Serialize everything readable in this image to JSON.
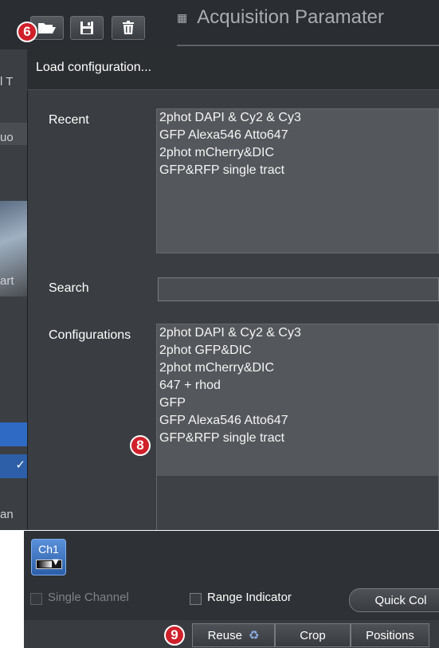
{
  "toolbar": {
    "title": "Acquisition Paramater"
  },
  "sidebar_fragments": [
    "l T",
    "uo",
    "art",
    "an"
  ],
  "dialog": {
    "title": "Load configuration...",
    "recent_label": "Recent",
    "recent_items": [
      "2phot DAPI & Cy2 & Cy3",
      "GFP Alexa546 Atto647",
      "2phot mCherry&DIC",
      "GFP&RFP single tract"
    ],
    "search_label": "Search",
    "search_value": "",
    "configurations_label": "Configurations",
    "configuration_items": [
      "2phot DAPI & Cy2 & Cy3",
      "2phot GFP&DIC",
      "2phot mCherry&DIC",
      "647 + rhod",
      "GFP",
      "GFP Alexa546 Atto647",
      "GFP&RFP single tract"
    ]
  },
  "markers": {
    "open": "6",
    "config_item": "8",
    "reuse": "9"
  },
  "channel": {
    "label": "Ch1"
  },
  "options": {
    "single_channel": "Single Channel",
    "range_indicator": "Range Indicator",
    "quick_color": "Quick Col"
  },
  "actions": {
    "reuse": "Reuse",
    "crop": "Crop",
    "positions": "Positions"
  },
  "icons": {
    "open": "folder-open-icon",
    "save": "floppy-disk-icon",
    "delete": "trash-icon",
    "reuse": "recycle-icon",
    "lut_dropdown": "chevron-down-icon"
  },
  "colors": {
    "marker": "#d0202b",
    "channel_button": "#3d73c4",
    "dialog_bg": "#3a3d41",
    "list_bg": "#54575b"
  }
}
